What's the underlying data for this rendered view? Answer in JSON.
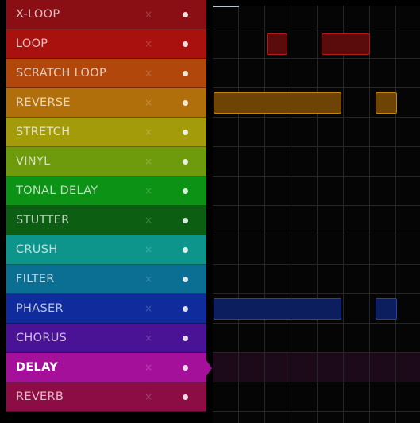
{
  "effects": [
    {
      "label": "X-LOOP",
      "close": "×",
      "color": "#8a0f14",
      "selected": false
    },
    {
      "label": "LOOP",
      "close": "×",
      "color": "#a9110e",
      "selected": false
    },
    {
      "label": "SCRATCH LOOP",
      "close": "×",
      "color": "#b2470c",
      "selected": false
    },
    {
      "label": "REVERSE",
      "close": "×",
      "color": "#b06f0a",
      "selected": false
    },
    {
      "label": "STRETCH",
      "close": "×",
      "color": "#a39b0a",
      "selected": false
    },
    {
      "label": "VINYL",
      "close": "×",
      "color": "#6e9b0c",
      "selected": false
    },
    {
      "label": "TONAL DELAY",
      "close": "×",
      "color": "#0c9215",
      "selected": false
    },
    {
      "label": "STUTTER",
      "close": "×",
      "color": "#0c5e12",
      "selected": false
    },
    {
      "label": "CRUSH",
      "close": "×",
      "color": "#0d958c",
      "selected": false
    },
    {
      "label": "FILTER",
      "close": "×",
      "color": "#0b6f93",
      "selected": false
    },
    {
      "label": "PHASER",
      "close": "×",
      "color": "#0f2b9c",
      "selected": false
    },
    {
      "label": "CHORUS",
      "close": "×",
      "color": "#4a1395",
      "selected": false
    },
    {
      "label": "DELAY",
      "close": "×",
      "color": "#a5109a",
      "selected": true
    },
    {
      "label": "REVERB",
      "close": "×",
      "color": "#8b0d43",
      "selected": false
    }
  ],
  "grid": {
    "columns": 8,
    "clips": [
      {
        "row": 1,
        "start": 2.06,
        "length": 0.78,
        "fill": "#5a0c0c",
        "border": "#b01b1b"
      },
      {
        "row": 1,
        "start": 4.16,
        "length": 1.84,
        "fill": "#5a0c0c",
        "border": "#b01b1b"
      },
      {
        "row": 3,
        "start": 0.04,
        "length": 4.88,
        "fill": "#6e4406",
        "border": "#c2850f"
      },
      {
        "row": 3,
        "start": 6.22,
        "length": 0.8,
        "fill": "#6e4406",
        "border": "#c2850f"
      },
      {
        "row": 10,
        "start": 0.04,
        "length": 4.88,
        "fill": "#0c1e5e",
        "border": "#2043b4"
      },
      {
        "row": 10,
        "start": 6.22,
        "length": 0.8,
        "fill": "#0c1e5e",
        "border": "#2043b4"
      }
    ]
  }
}
